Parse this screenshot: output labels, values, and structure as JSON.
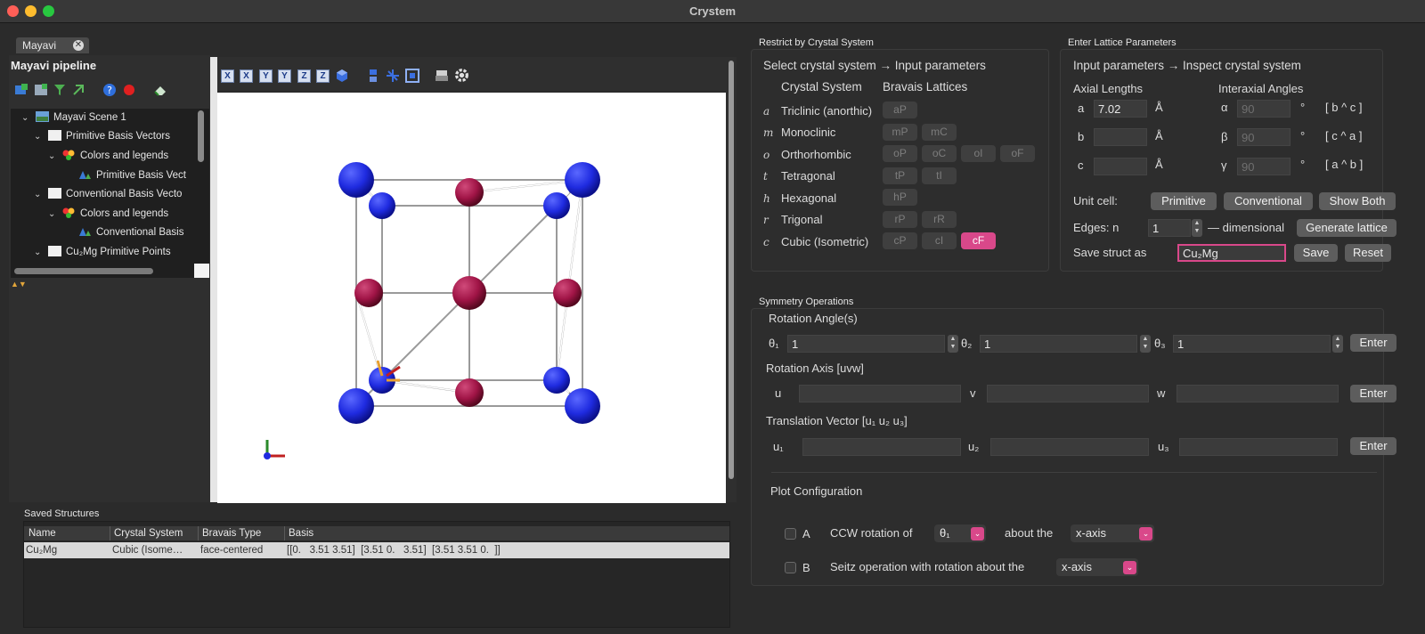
{
  "window": {
    "title": "Crystem"
  },
  "mayavi": {
    "tab_label": "Mayavi",
    "pipeline_title": "Mayavi pipeline",
    "tree": [
      {
        "label": "Mayavi Scene 1"
      },
      {
        "label": "Primitive Basis Vectors"
      },
      {
        "label": "Colors and legends"
      },
      {
        "label": "Primitive Basis Vect"
      },
      {
        "label": "Conventional Basis Vecto"
      },
      {
        "label": "Colors and legends"
      },
      {
        "label": "Conventional Basis"
      },
      {
        "label": "Cu₂Mg Primitive Points"
      }
    ],
    "viewer_toolbar": [
      "X",
      "X",
      "Y",
      "Y",
      "Z",
      "Z"
    ]
  },
  "saved": {
    "title": "Saved Structures",
    "columns": [
      "Name",
      "Crystal System",
      "Bravais Type",
      "Basis"
    ],
    "rows": [
      {
        "name": "Cu₂Mg",
        "system": "Cubic (Isome…",
        "type": "face-centered",
        "basis": "[[0.   3.51 3.51]  [3.51 0.   3.51]  [3.51 3.51 0.  ]]"
      }
    ]
  },
  "restrict": {
    "group_title": "Restrict by Crystal System",
    "heading": "Select crystal system → Input parameters",
    "col_system": "Crystal System",
    "col_bravais": "Bravais Lattices",
    "systems": [
      {
        "symbol": "a",
        "name": "Triclinic (anorthic)",
        "lattices": [
          "aP"
        ]
      },
      {
        "symbol": "m",
        "name": "Monoclinic",
        "lattices": [
          "mP",
          "mC"
        ]
      },
      {
        "symbol": "o",
        "name": "Orthorhombic",
        "lattices": [
          "oP",
          "oC",
          "oI",
          "oF"
        ]
      },
      {
        "symbol": "t",
        "name": "Tetragonal",
        "lattices": [
          "tP",
          "tI"
        ]
      },
      {
        "symbol": "h",
        "name": "Hexagonal",
        "lattices": [
          "hP"
        ]
      },
      {
        "symbol": "r",
        "name": "Trigonal",
        "lattices": [
          "rP",
          "rR"
        ]
      },
      {
        "symbol": "c",
        "name": "Cubic (Isometric)",
        "lattices": [
          "cP",
          "cI",
          "cF"
        ]
      }
    ],
    "selected_lattice": "cF"
  },
  "lattice": {
    "group_title": "Enter Lattice Parameters",
    "heading": "Input parameters → Inspect crystal system",
    "axial_title": "Axial Lengths",
    "angles_title": "Interaxial Angles",
    "axes": [
      {
        "label": "a",
        "value": "7.02",
        "unit": "Å"
      },
      {
        "label": "b",
        "value": "",
        "unit": "Å"
      },
      {
        "label": "c",
        "value": "",
        "unit": "Å"
      }
    ],
    "angles": [
      {
        "label": "α",
        "value": "90",
        "unit": "°",
        "pair": "[ b ^ c ]"
      },
      {
        "label": "β",
        "value": "90",
        "unit": "°",
        "pair": "[ c ^ a ]"
      },
      {
        "label": "γ",
        "value": "90",
        "unit": "°",
        "pair": "[ a ^ b ]"
      }
    ],
    "unit_cell_label": "Unit cell:",
    "btn_primitive": "Primitive",
    "btn_conventional": "Conventional",
    "btn_both": "Show Both",
    "edges_label": "Edges: n",
    "edges_value": "1",
    "edges_suffix": "— dimensional",
    "btn_generate": "Generate lattice",
    "save_label": "Save struct as",
    "save_value": "Cu₂Mg",
    "btn_save": "Save",
    "btn_reset": "Reset"
  },
  "symmetry": {
    "group_title": "Symmetry Operations",
    "rotation_title": "Rotation Angle(s)",
    "theta_labels": [
      "θ₁",
      "θ₂",
      "θ₃"
    ],
    "theta_values": [
      "1",
      "1",
      "1"
    ],
    "axis_title": "Rotation Axis [uvw]",
    "axis_labels": [
      "u",
      "v",
      "w"
    ],
    "trans_title": "Translation Vector [u₁ u₂ u₃]",
    "trans_labels": [
      "u₁",
      "u₂",
      "u₃"
    ],
    "enter": "Enter",
    "plot_title": "Plot Configuration",
    "optA_letter": "A",
    "optA_text": "CCW rotation of",
    "optA_combo": "θ₁",
    "optA_about": "about the",
    "optA_axis": "x-axis",
    "optB_letter": "B",
    "optB_text": "Seitz operation with rotation about the",
    "optB_axis": "x-axis"
  },
  "colors": {
    "accent": "#d9488a",
    "atom_blue": "#1f2be0",
    "atom_red": "#a01446"
  }
}
